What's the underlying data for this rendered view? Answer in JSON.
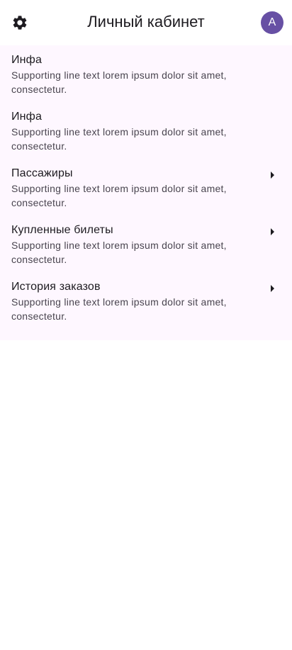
{
  "header": {
    "title": "Личный кабинет",
    "settings_icon": "gear-icon",
    "avatar_initial": "A",
    "avatar_color": "#6750a4"
  },
  "list": {
    "background": "#fef7ff",
    "items": [
      {
        "title": "Инфа",
        "supporting": "Supporting line text lorem ipsum dolor sit amet, consectetur.",
        "has_arrow": false
      },
      {
        "title": "Инфа",
        "supporting": "Supporting line text lorem ipsum dolor sit amet, consectetur.",
        "has_arrow": false
      },
      {
        "title": "Пассажиры",
        "supporting": "Supporting line text lorem ipsum dolor sit amet, consectetur.",
        "has_arrow": true
      },
      {
        "title": "Купленные билеты",
        "supporting": "Supporting line text lorem ipsum dolor sit amet, consectetur.",
        "has_arrow": true
      },
      {
        "title": "История заказов",
        "supporting": "Supporting line text lorem ipsum dolor sit amet, consectetur.",
        "has_arrow": true
      }
    ]
  }
}
